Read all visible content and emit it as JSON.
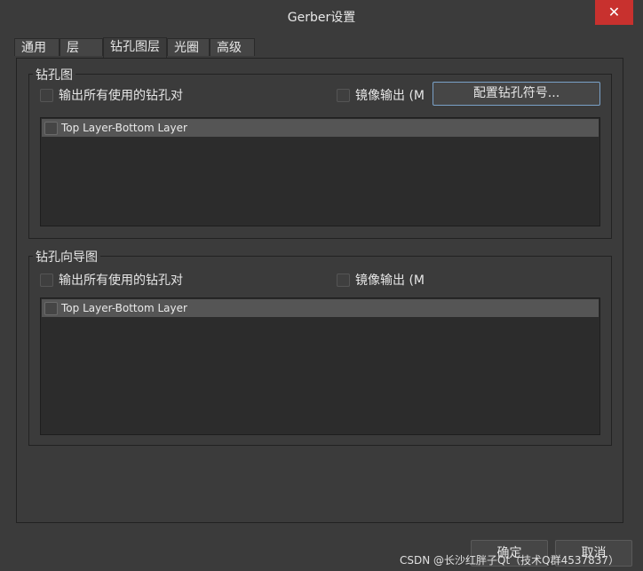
{
  "window": {
    "title": "Gerber设置",
    "close_symbol": "✕"
  },
  "tabs": [
    {
      "label": "通用"
    },
    {
      "label": "层"
    },
    {
      "label": "钻孔图层"
    },
    {
      "label": "光圈"
    },
    {
      "label": "高级"
    }
  ],
  "active_tab": "钻孔图层",
  "drill_drawing": {
    "title": "钻孔图",
    "output_all_pairs_label": "输出所有使用的钻孔对",
    "mirror_label": "镜像输出 (M",
    "config_button_label": "配置钻孔符号...",
    "list_items": [
      {
        "label": "Top Layer-Bottom Layer",
        "checked": false
      }
    ],
    "output_all_pairs_checked": false,
    "mirror_checked": false
  },
  "drill_guide": {
    "title": "钻孔向导图",
    "output_all_pairs_label": "输出所有使用的钻孔对",
    "mirror_label": "镜像输出 (M",
    "list_items": [
      {
        "label": "Top Layer-Bottom Layer",
        "checked": false
      }
    ],
    "output_all_pairs_checked": false,
    "mirror_checked": false
  },
  "footer": {
    "ok_label": "确定",
    "cancel_label": "取消"
  },
  "watermark": "CSDN @长沙红胖子Qt（技术Q群4537837）",
  "colors": {
    "background": "#3b3b3b",
    "close_button": "#c8312e",
    "focus_border": "#7aa1c8"
  }
}
